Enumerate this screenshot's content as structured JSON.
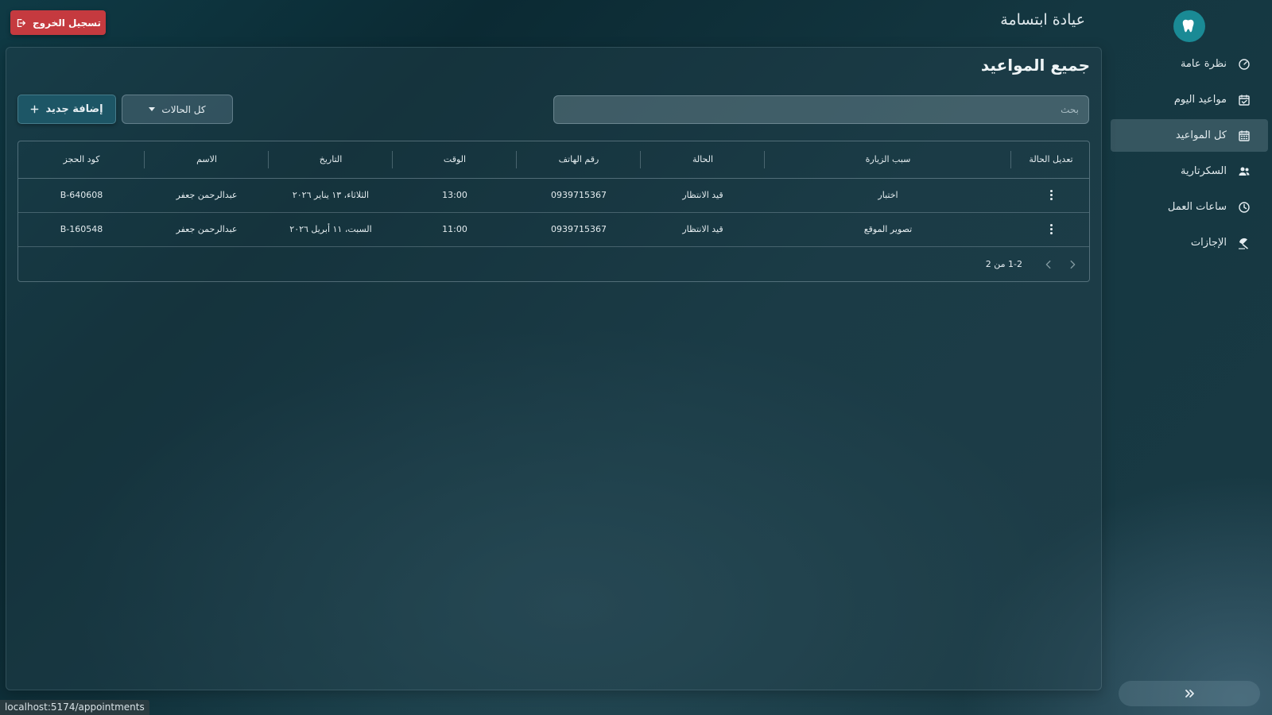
{
  "header": {
    "app_title": "عيادة ابتسامة",
    "logout_label": "تسجيل الخروج"
  },
  "sidebar": {
    "items": [
      {
        "label": "نظرة عامة",
        "icon": "gauge-icon",
        "active": false
      },
      {
        "label": "مواعيد اليوم",
        "icon": "calendar-check-icon",
        "active": false
      },
      {
        "label": "كل المواعيد",
        "icon": "calendar-grid-icon",
        "active": true
      },
      {
        "label": "السكرتارية",
        "icon": "users-icon",
        "active": false
      },
      {
        "label": "ساعات العمل",
        "icon": "clock-icon",
        "active": false
      },
      {
        "label": "الإجازات",
        "icon": "beach-umbrella-icon",
        "active": false
      }
    ],
    "collapse_icon": "double-chevron-icon"
  },
  "main": {
    "title": "جميع المواعيد",
    "search": {
      "placeholder": "بحث",
      "value": ""
    },
    "status_filter": {
      "selected": "كل الحالات"
    },
    "add_button": {
      "label": "إضافة جديد"
    },
    "table": {
      "columns": [
        "تعديل الحالة",
        "سبب الزيارة",
        "الحالة",
        "رقم الهاتف",
        "الوقت",
        "التاريخ",
        "الاسم",
        "كود الحجز"
      ],
      "rows": [
        {
          "reason": "اختبار",
          "status": "قيد الانتظار",
          "phone": "0939715367",
          "time": "13:00",
          "date": "الثلاثاء، ١٣ يناير ٢٠٢٦",
          "name": "عبدالرحمن جعفر",
          "code": "B-640608"
        },
        {
          "reason": "تصوير الموقع",
          "status": "قيد الانتظار",
          "phone": "0939715367",
          "time": "11:00",
          "date": "السبت، ١١ أبريل ٢٠٢٦",
          "name": "عبدالرحمن جعفر",
          "code": "B-160548"
        }
      ]
    },
    "pagination": {
      "info": "1-2 من 2"
    }
  },
  "status_bar": {
    "url": "localhost:5174/appointments"
  },
  "colors": {
    "logout": "#c53a3f",
    "accent": "#1d5666",
    "logo": "#1a8a95"
  }
}
